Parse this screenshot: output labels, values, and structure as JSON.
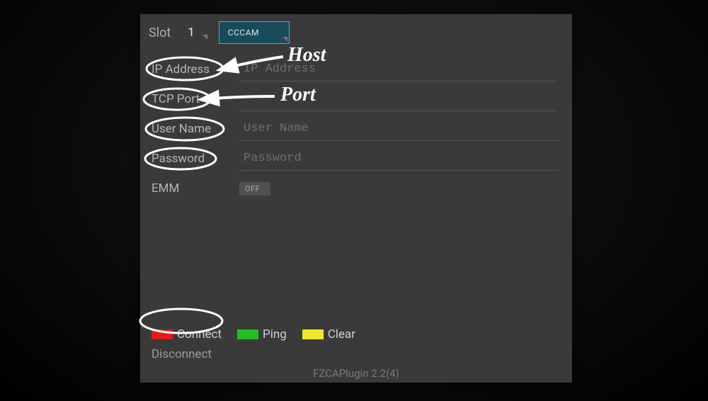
{
  "slot": {
    "label": "Slot",
    "value": "1"
  },
  "protocol": {
    "selected": "CCCAM"
  },
  "fields": {
    "ip": {
      "label": "IP Address",
      "placeholder": "IP Address",
      "value": ""
    },
    "port": {
      "label": "TCP Port",
      "placeholder": "",
      "value": ""
    },
    "user": {
      "label": "User Name",
      "placeholder": "User Name",
      "value": ""
    },
    "pass": {
      "label": "Password",
      "placeholder": "Password",
      "value": ""
    },
    "emm": {
      "label": "EMM",
      "toggle": "OFF"
    }
  },
  "actions": {
    "connect": "Connect",
    "ping": "Ping",
    "clear": "Clear"
  },
  "status": "Disconnect",
  "footer": "FZCAPlugin 2.2(4)",
  "annotations": {
    "host": "Host",
    "port": "Port"
  }
}
